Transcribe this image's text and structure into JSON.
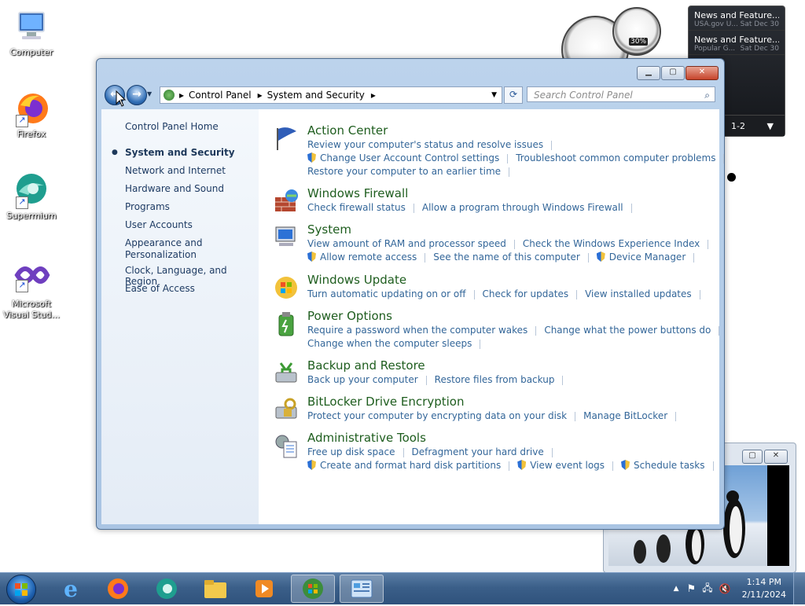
{
  "desktop": {
    "icons": [
      {
        "label": "Computer"
      },
      {
        "label": "Firefox"
      },
      {
        "label": "Supermium"
      },
      {
        "label": "Microsoft Visual Stud..."
      }
    ]
  },
  "gadgets": {
    "cpu_meter": {
      "value_label": "30%"
    },
    "news": {
      "items": [
        {
          "headline": "News and Feature...",
          "source": "USA.gov U...",
          "date": "Sat Dec 30"
        },
        {
          "headline": "News and Feature...",
          "source": "Popular G...",
          "date": "Sat Dec 30"
        }
      ],
      "pager": "1-2"
    }
  },
  "window": {
    "address": {
      "crumbs": [
        "Control Panel",
        "System and Security"
      ]
    },
    "search_placeholder": "Search Control Panel",
    "left_nav": {
      "home": "Control Panel Home",
      "items": [
        {
          "label": "System and Security",
          "selected": true
        },
        {
          "label": "Network and Internet"
        },
        {
          "label": "Hardware and Sound"
        },
        {
          "label": "Programs"
        },
        {
          "label": "User Accounts"
        },
        {
          "label": "Appearance and\nPersonalization"
        },
        {
          "label": "Clock, Language, and Region"
        },
        {
          "label": "Ease of Access"
        }
      ]
    },
    "categories": [
      {
        "title": "Action Center",
        "rows": [
          [
            {
              "t": "Review your computer's status and resolve issues"
            }
          ],
          [
            {
              "t": "Change User Account Control settings",
              "shield": true
            },
            {
              "t": "Troubleshoot common computer problems"
            }
          ],
          [
            {
              "t": "Restore your computer to an earlier time"
            }
          ]
        ]
      },
      {
        "title": "Windows Firewall",
        "rows": [
          [
            {
              "t": "Check firewall status"
            },
            {
              "t": "Allow a program through Windows Firewall"
            }
          ]
        ]
      },
      {
        "title": "System",
        "rows": [
          [
            {
              "t": "View amount of RAM and processor speed"
            },
            {
              "t": "Check the Windows Experience Index"
            }
          ],
          [
            {
              "t": "Allow remote access",
              "shield": true
            },
            {
              "t": "See the name of this computer"
            },
            {
              "t": "Device Manager",
              "shield": true
            }
          ]
        ]
      },
      {
        "title": "Windows Update",
        "rows": [
          [
            {
              "t": "Turn automatic updating on or off"
            },
            {
              "t": "Check for updates"
            },
            {
              "t": "View installed updates"
            }
          ]
        ]
      },
      {
        "title": "Power Options",
        "rows": [
          [
            {
              "t": "Require a password when the computer wakes"
            },
            {
              "t": "Change what the power buttons do"
            }
          ],
          [
            {
              "t": "Change when the computer sleeps"
            }
          ]
        ]
      },
      {
        "title": "Backup and Restore",
        "rows": [
          [
            {
              "t": "Back up your computer"
            },
            {
              "t": "Restore files from backup"
            }
          ]
        ]
      },
      {
        "title": "BitLocker Drive Encryption",
        "rows": [
          [
            {
              "t": "Protect your computer by encrypting data on your disk"
            },
            {
              "t": "Manage BitLocker"
            }
          ]
        ]
      },
      {
        "title": "Administrative Tools",
        "rows": [
          [
            {
              "t": "Free up disk space"
            },
            {
              "t": "Defragment your hard drive"
            }
          ],
          [
            {
              "t": "Create and format hard disk partitions",
              "shield": true
            },
            {
              "t": "View event logs",
              "shield": true
            },
            {
              "t": "Schedule tasks",
              "shield": true
            }
          ]
        ]
      }
    ]
  },
  "taskbar": {
    "clock": {
      "time": "1:14 PM",
      "date": "2/11/2024"
    }
  },
  "colors": {
    "link": "#336699",
    "category_title": "#1e5d1e",
    "taskbar": "#3b5f89"
  }
}
